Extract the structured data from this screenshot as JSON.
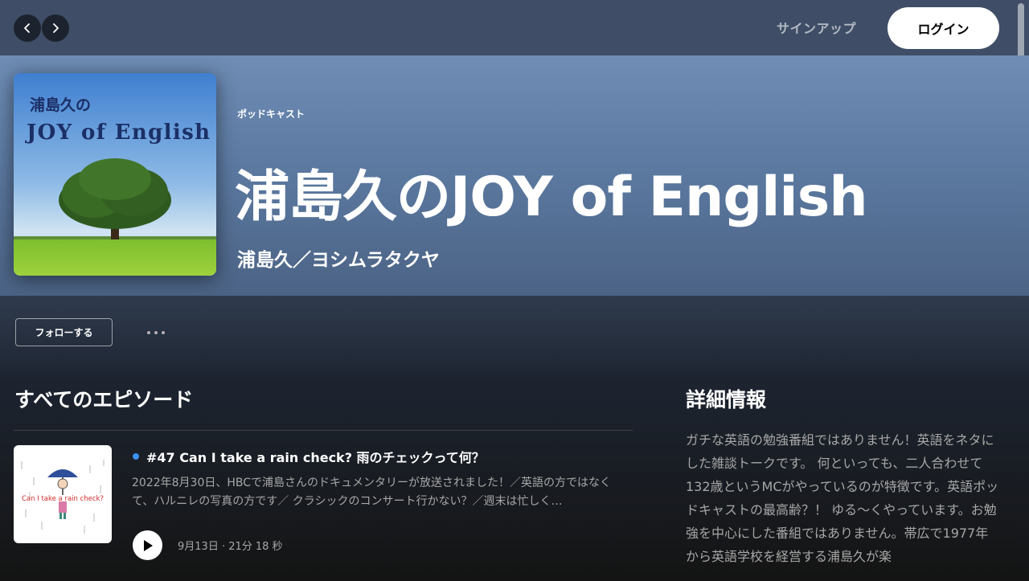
{
  "topbar": {
    "signup_label": "サインアップ",
    "login_label": "ログイン"
  },
  "hero": {
    "type_label": "ポッドキャスト",
    "title": "浦島久のJOY of English",
    "author": "浦島久／ヨシムラタクヤ",
    "cover_text_line1": "浦島久の",
    "cover_text_line2": "JOY of English"
  },
  "actions": {
    "follow_label": "フォローする"
  },
  "episodes": {
    "section_title": "すべてのエピソード",
    "items": [
      {
        "title": "#47 Can I take a rain check? 雨のチェックって何？",
        "description": "2022年8月30日、HBCで浦島さんのドキュメンタリーが放送されました！／英語の方ではなくて、ハルニレの写真の方です／ クラシックのコンサート行かない？／週末は忙しく…",
        "meta": "9月13日 · 21分 18 秒",
        "thumb_text": "Can I take a rain check?"
      }
    ]
  },
  "details": {
    "title": "詳細情報",
    "body": "ガチな英語の勉強番組ではありません！英語をネタにした雑談トークです。 何といっても、二人合わせて132歳というMCがやっているのが特徴です。英語ポッドキャストの最高齢？！ ゆる〜くやっています。お勉強を中心にした番組ではありません。帯広で1977年から英語学校を経営する浦島久が楽"
  },
  "colors": {
    "accent_dot": "#3d91f4",
    "topbar": "#3f4e66",
    "hero_top": "#6f8db5"
  }
}
